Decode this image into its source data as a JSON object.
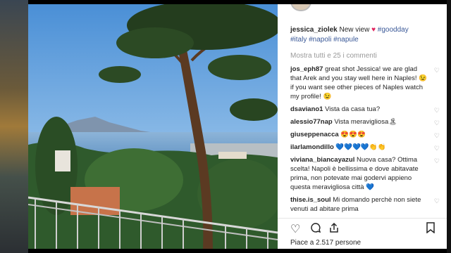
{
  "post": {
    "author": "jessica_ziolek",
    "caption_text": "New view",
    "caption_heart": "♥",
    "hashtags_line1": "#goodday",
    "hashtags_line2": "#italy #napoli #napule"
  },
  "view_all_label": "Mostra tutti e 25 i commenti",
  "comments": [
    {
      "user": "jos_eph87",
      "text": "great shot Jessica! we are glad that Arek and you stay well here in Naples! 😉 if you want see other pieces of Naples watch my profile! 😉"
    },
    {
      "user": "dsaviano1",
      "text": "Vista da casa tua?"
    },
    {
      "user": "alessio77nap",
      "text": "Vista meravigliosa🏝"
    },
    {
      "user": "giuseppenacca",
      "text": "😍😍😍"
    },
    {
      "user": "ilarlamondillo",
      "text": "💙💙💙💙👏👏"
    },
    {
      "user": "viviana_biancayazul",
      "text": "Nuova casa? Ottima scelta! Napoli è bellissima e dove abitavate prima, non potevate mai godervi appieno questa meravigliosa città 💙"
    },
    {
      "user": "thise.is_soul",
      "text": "Mi domando perchè non siete venuti ad abitare prima"
    }
  ],
  "likes_text": "Piace a 2.517 persone",
  "icons": {
    "like": "heart-outline-icon",
    "comment": "comment-bubble-icon",
    "share": "share-icon",
    "save": "bookmark-icon"
  }
}
